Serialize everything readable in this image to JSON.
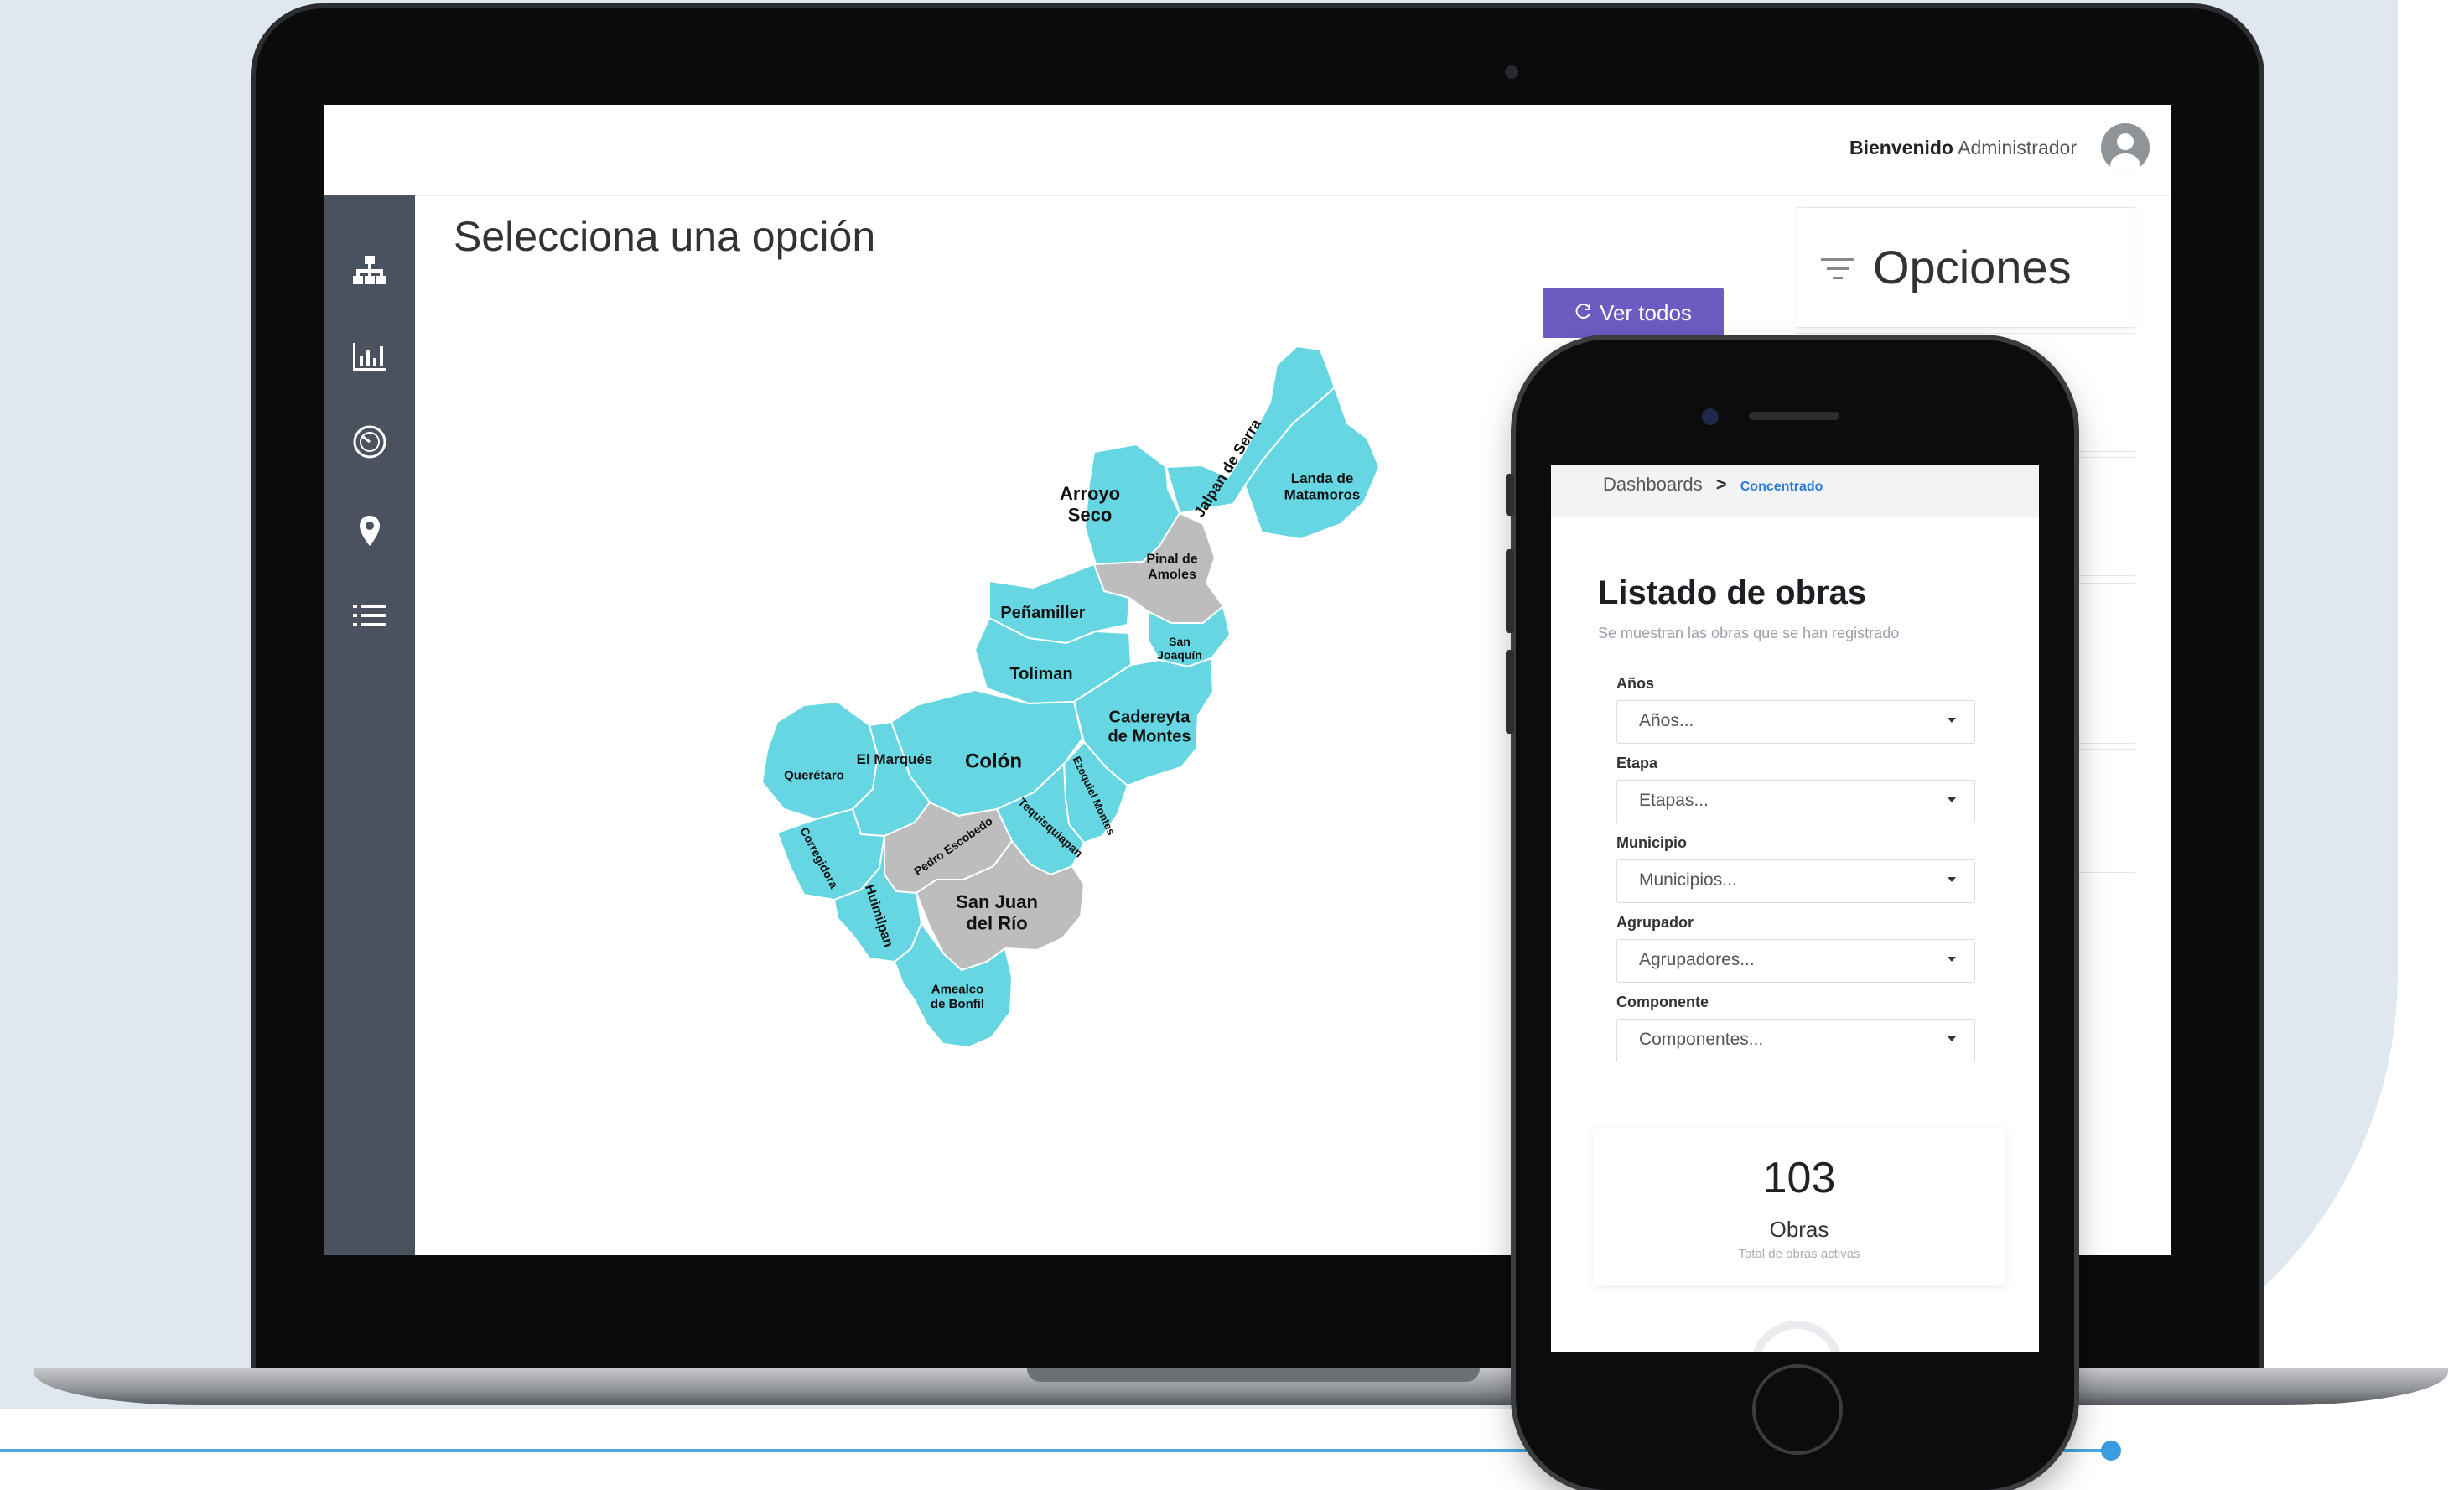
{
  "header": {
    "welcome_bold": "Bienvenido",
    "welcome_name": "Administrador"
  },
  "sidebar": {
    "items": [
      {
        "icon": "sitemap-icon"
      },
      {
        "icon": "bar-chart-icon"
      },
      {
        "icon": "gauge-icon"
      },
      {
        "icon": "map-marker-icon"
      },
      {
        "icon": "list-icon"
      }
    ]
  },
  "main": {
    "title": "Selecciona una opción",
    "ver_todos": "Ver todos",
    "options_title": "Opciones"
  },
  "map": {
    "colors": {
      "active": "#66d6e2",
      "inactive": "#bdbdbd",
      "border": "#ffffff"
    },
    "regions": [
      {
        "name": "Arroyo Seco",
        "lines": [
          "Arroyo",
          "Seco"
        ],
        "state": "active"
      },
      {
        "name": "Jalpan de Serra",
        "lines": [
          "Jalpan de Serra"
        ],
        "state": "active"
      },
      {
        "name": "Landa de Matamoros",
        "lines": [
          "Landa de",
          "Matamoros"
        ],
        "state": "active"
      },
      {
        "name": "Pinal de Amoles",
        "lines": [
          "Pinal de",
          "Amoles"
        ],
        "state": "inactive"
      },
      {
        "name": "Peñamiller",
        "lines": [
          "Peñamiller"
        ],
        "state": "active"
      },
      {
        "name": "San Joaquín",
        "lines": [
          "San",
          "Joaquín"
        ],
        "state": "active"
      },
      {
        "name": "Toliman",
        "lines": [
          "Toliman"
        ],
        "state": "active"
      },
      {
        "name": "Colón",
        "lines": [
          "Colón"
        ],
        "state": "active"
      },
      {
        "name": "Cadereyta de Montes",
        "lines": [
          "Cadereyta",
          "de Montes"
        ],
        "state": "active"
      },
      {
        "name": "Querétaro",
        "lines": [
          "Querétaro"
        ],
        "state": "active"
      },
      {
        "name": "El Marqués",
        "lines": [
          "El Marqués"
        ],
        "state": "active"
      },
      {
        "name": "Ezequiel Montes",
        "lines": [
          "Ezequiel Montes"
        ],
        "state": "active"
      },
      {
        "name": "Tequisquiapan",
        "lines": [
          "Tequisquiapan"
        ],
        "state": "active"
      },
      {
        "name": "Corregidora",
        "lines": [
          "Corregidora"
        ],
        "state": "active"
      },
      {
        "name": "Pedro Escobedo",
        "lines": [
          "Pedro Escobedo"
        ],
        "state": "inactive"
      },
      {
        "name": "Huimilpan",
        "lines": [
          "Huimilpan"
        ],
        "state": "active"
      },
      {
        "name": "San Juan del Río",
        "lines": [
          "San Juan",
          "del Río"
        ],
        "state": "inactive"
      },
      {
        "name": "Amealco de Bonfil",
        "lines": [
          "Amealco",
          "de Bonfil"
        ],
        "state": "active"
      }
    ]
  },
  "phone": {
    "breadcrumb": {
      "root": "Dashboards",
      "separator": ">",
      "current": "Concentrado"
    },
    "title": "Listado de obras",
    "subtitle": "Se muestran las obras que se han registrado",
    "filters": [
      {
        "label": "Años",
        "placeholder": "Años..."
      },
      {
        "label": "Etapa",
        "placeholder": "Etapas..."
      },
      {
        "label": "Municipio",
        "placeholder": "Municipios..."
      },
      {
        "label": "Agrupador",
        "placeholder": "Agrupadores..."
      },
      {
        "label": "Componente",
        "placeholder": "Componentes..."
      }
    ],
    "stat": {
      "value": "103",
      "label": "Obras",
      "sublabel": "Total de obras activas"
    }
  }
}
